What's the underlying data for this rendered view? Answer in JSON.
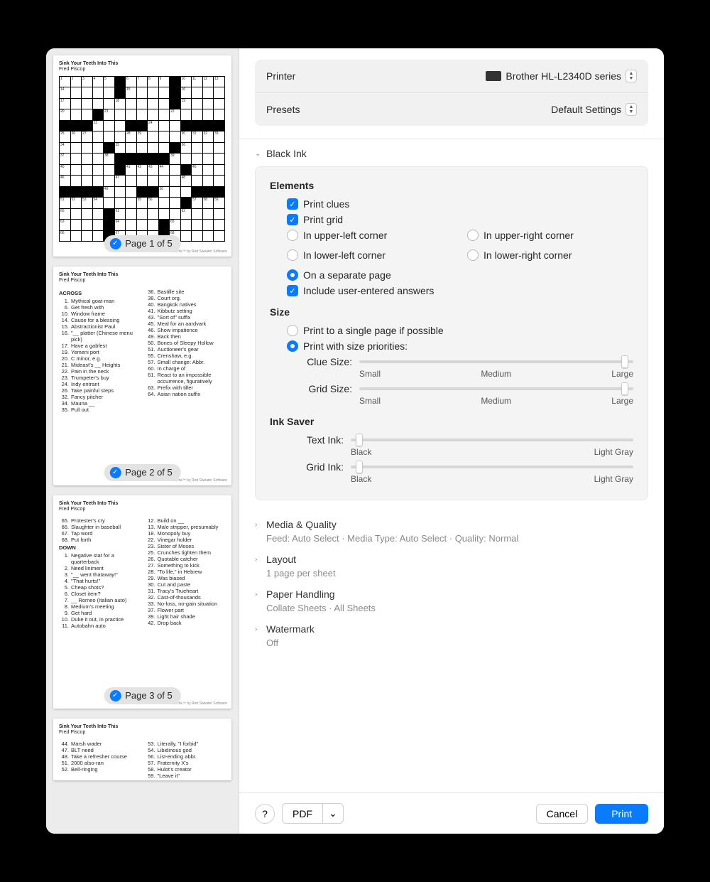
{
  "puzzle": {
    "title": "Sink Your Teeth Into This",
    "author": "Fred Piscop",
    "footer": "…ack Ink™ by Red Sweater Software"
  },
  "grid_rows": [
    [
      {
        "n": "1"
      },
      {
        "n": "2"
      },
      {
        "n": "3"
      },
      {
        "n": "4"
      },
      {
        "n": "5"
      },
      {
        "b": 1
      },
      {
        "n": "6"
      },
      {
        "n": "7"
      },
      {
        "n": "8"
      },
      {
        "n": "9"
      },
      {
        "b": 1
      },
      {
        "n": "10"
      },
      {
        "n": "11"
      },
      {
        "n": "12"
      },
      {
        "n": "13"
      }
    ],
    [
      {
        "n": "14"
      },
      {},
      {},
      {},
      {},
      {
        "b": 1
      },
      {
        "n": "15"
      },
      {},
      {},
      {},
      {
        "b": 1
      },
      {
        "n": "16"
      },
      {},
      {},
      {}
    ],
    [
      {
        "n": "17"
      },
      {},
      {},
      {},
      {},
      {
        "n": "18"
      },
      {},
      {},
      {},
      {},
      {
        "b": 1
      },
      {
        "n": "19"
      },
      {},
      {},
      {}
    ],
    [
      {
        "n": "20"
      },
      {},
      {},
      {
        "b": 1
      },
      {
        "n": "21"
      },
      {},
      {},
      {},
      {},
      {},
      {
        "n": "22"
      },
      {},
      {},
      {},
      {}
    ],
    [
      {
        "b": 1
      },
      {
        "b": 1
      },
      {
        "b": 1
      },
      {
        "n": "23"
      },
      {},
      {},
      {
        "b": 1
      },
      {
        "b": 1
      },
      {
        "n": "24"
      },
      {},
      {},
      {
        "b": 1
      },
      {
        "b": 1
      },
      {
        "b": 1
      },
      {
        "b": 1
      }
    ],
    [
      {
        "n": "25"
      },
      {
        "n": "26"
      },
      {
        "n": "27"
      },
      {},
      {},
      {},
      {
        "n": "28"
      },
      {
        "n": "29"
      },
      {},
      {},
      {},
      {
        "n": "30"
      },
      {
        "n": "31"
      },
      {
        "n": "32"
      },
      {
        "n": "33"
      }
    ],
    [
      {
        "n": "34"
      },
      {},
      {},
      {},
      {
        "b": 1
      },
      {
        "n": "35"
      },
      {},
      {},
      {},
      {},
      {
        "b": 1
      },
      {
        "n": "36"
      },
      {},
      {},
      {}
    ],
    [
      {
        "n": "37"
      },
      {},
      {},
      {},
      {
        "n": "38"
      },
      {
        "b": 1
      },
      {
        "b": 1
      },
      {
        "b": 1
      },
      {
        "b": 1
      },
      {
        "b": 1
      },
      {
        "n": "39"
      },
      {},
      {},
      {},
      {}
    ],
    [
      {
        "n": "40"
      },
      {},
      {},
      {},
      {},
      {
        "b": 1
      },
      {
        "n": "41"
      },
      {
        "n": "42"
      },
      {
        "n": "43"
      },
      {
        "n": "44"
      },
      {},
      {
        "b": 1
      },
      {
        "n": "45"
      },
      {},
      {}
    ],
    [
      {
        "n": "46"
      },
      {},
      {},
      {},
      {},
      {
        "n": "47"
      },
      {},
      {},
      {},
      {},
      {},
      {
        "n": "48"
      },
      {},
      {},
      {}
    ],
    [
      {
        "b": 1
      },
      {
        "b": 1
      },
      {
        "b": 1
      },
      {
        "b": 1
      },
      {
        "n": "49"
      },
      {},
      {},
      {
        "b": 1
      },
      {
        "b": 1
      },
      {
        "n": "50"
      },
      {},
      {},
      {
        "b": 1
      },
      {
        "b": 1
      },
      {
        "b": 1
      }
    ],
    [
      {
        "n": "51"
      },
      {
        "n": "52"
      },
      {
        "n": "53"
      },
      {
        "n": "54"
      },
      {},
      {},
      {},
      {
        "n": "55"
      },
      {
        "n": "56"
      },
      {},
      {},
      {
        "b": 1
      },
      {
        "n": "57"
      },
      {
        "n": "58"
      },
      {
        "n": "59"
      }
    ],
    [
      {
        "n": "60"
      },
      {},
      {},
      {},
      {
        "b": 1
      },
      {
        "n": "61"
      },
      {},
      {},
      {},
      {},
      {},
      {
        "n": "62"
      },
      {},
      {},
      {}
    ],
    [
      {
        "n": "63"
      },
      {},
      {},
      {},
      {
        "b": 1
      },
      {
        "n": "64"
      },
      {},
      {},
      {},
      {
        "b": 1
      },
      {
        "n": "65"
      },
      {},
      {},
      {},
      {}
    ],
    [
      {
        "n": "66"
      },
      {},
      {},
      {},
      {
        "b": 1
      },
      {
        "n": "67"
      },
      {},
      {},
      {},
      {
        "b": 1
      },
      {
        "n": "68"
      },
      {},
      {},
      {},
      {}
    ]
  ],
  "clues": {
    "across1": [
      {
        "n": "1",
        "t": "Mythical goat-man"
      },
      {
        "n": "6",
        "t": "Get fresh with"
      },
      {
        "n": "10",
        "t": "Window frame"
      },
      {
        "n": "14",
        "t": "Cause for a blessing"
      },
      {
        "n": "15",
        "t": "Abstractionist Paul"
      },
      {
        "n": "16",
        "t": "\"__ platter (Chinese menu pick)"
      },
      {
        "n": "17",
        "t": "Have a gabfest"
      },
      {
        "n": "19",
        "t": "Yemeni port"
      },
      {
        "n": "20",
        "t": "C minor, e.g."
      },
      {
        "n": "21",
        "t": "Mideast's __ Heights"
      },
      {
        "n": "22",
        "t": "Pain in the neck"
      },
      {
        "n": "23",
        "t": "Trumpeter's buy"
      },
      {
        "n": "24",
        "t": "Indy entrant"
      },
      {
        "n": "26",
        "t": "Take painful steps"
      },
      {
        "n": "32",
        "t": "Fancy pitcher"
      },
      {
        "n": "34",
        "t": "Mauna __"
      },
      {
        "n": "35",
        "t": "Pull out"
      }
    ],
    "across2": [
      {
        "n": "36",
        "t": "Bastille site"
      },
      {
        "n": "38",
        "t": "Court org."
      },
      {
        "n": "40",
        "t": "Bangkok natives"
      },
      {
        "n": "41",
        "t": "Kibbutz setting"
      },
      {
        "n": "43",
        "t": "\"Sort of\" suffix"
      },
      {
        "n": "45",
        "t": "Meal for an aardvark"
      },
      {
        "n": "46",
        "t": "Show impatience"
      },
      {
        "n": "49",
        "t": "Back then"
      },
      {
        "n": "50",
        "t": "Bones of Sleepy Hollow"
      },
      {
        "n": "51",
        "t": "Auctioneer's gear"
      },
      {
        "n": "55",
        "t": "Crenshaw, e.g."
      },
      {
        "n": "57",
        "t": "Small change: Abbr."
      },
      {
        "n": "60",
        "t": "In charge of"
      },
      {
        "n": "61",
        "t": "React to an impossible occurrence, figuratively"
      },
      {
        "n": "63",
        "t": "Prefix with tiller"
      },
      {
        "n": "64",
        "t": "Asian nation suffix"
      }
    ],
    "p3left": [
      {
        "n": "65",
        "t": "Protester's cry"
      },
      {
        "n": "66",
        "t": "Slaughter in baseball"
      },
      {
        "n": "67",
        "t": "Tap word"
      },
      {
        "n": "68",
        "t": "Put forth"
      }
    ],
    "down1": [
      {
        "n": "1",
        "t": "Negative stat for a quarterback"
      },
      {
        "n": "2",
        "t": "Need liniment"
      },
      {
        "n": "3",
        "t": "\"__ went thataway!\""
      },
      {
        "n": "4",
        "t": "\"That hurts!\""
      },
      {
        "n": "5",
        "t": "Cheap shots?"
      },
      {
        "n": "6",
        "t": "Closet item?"
      },
      {
        "n": "7",
        "t": "__ Romeo (Italian auto)"
      },
      {
        "n": "8",
        "t": "Medium's meeting"
      },
      {
        "n": "9",
        "t": "Get hard"
      },
      {
        "n": "10",
        "t": "Duke it out, in practice"
      },
      {
        "n": "11",
        "t": "Autobahn auto"
      }
    ],
    "down2": [
      {
        "n": "12",
        "t": "Build on __"
      },
      {
        "n": "13",
        "t": "Male stripper, presumably"
      },
      {
        "n": "18",
        "t": "Monopoly buy"
      },
      {
        "n": "22",
        "t": "Vinegar holder"
      },
      {
        "n": "23",
        "t": "Sister of Moses"
      },
      {
        "n": "25",
        "t": "Crunches tighten them"
      },
      {
        "n": "26",
        "t": "Quotable catcher"
      },
      {
        "n": "27",
        "t": "Something to kick"
      },
      {
        "n": "28",
        "t": "\"To life,\" in Hebrew"
      },
      {
        "n": "29",
        "t": "Was biased"
      },
      {
        "n": "30",
        "t": "Cut and paste"
      },
      {
        "n": "31",
        "t": "Tracy's Trueheart"
      },
      {
        "n": "32",
        "t": "Cast-of-thousands"
      },
      {
        "n": "33",
        "t": "No-loss, no-gain situation"
      },
      {
        "n": "37",
        "t": "Flower part"
      },
      {
        "n": "39",
        "t": "Light hair shade"
      },
      {
        "n": "42",
        "t": "Drop back"
      }
    ],
    "p4left": [
      {
        "n": "44",
        "t": "Marsh wader"
      },
      {
        "n": "47",
        "t": "BLT need"
      },
      {
        "n": "48",
        "t": "Take a refresher course"
      },
      {
        "n": "51",
        "t": "2000 also-ran"
      },
      {
        "n": "52",
        "t": "Bell-ringing"
      }
    ],
    "p4right": [
      {
        "n": "53",
        "t": "Literally, \"I forbid\""
      },
      {
        "n": "54",
        "t": "Libidinous god"
      },
      {
        "n": "56",
        "t": "List-ending abbr."
      },
      {
        "n": "57",
        "t": "Fraternity X's"
      },
      {
        "n": "58",
        "t": "Hulot's creator"
      },
      {
        "n": "59",
        "t": "\"Leave it\""
      }
    ]
  },
  "pages": {
    "p1": "Page 1 of 5",
    "p2": "Page 2 of 5",
    "p3": "Page 3 of 5"
  },
  "top": {
    "printer_label": "Printer",
    "printer_value": "Brother HL-L2340D series",
    "presets_label": "Presets",
    "presets_value": "Default Settings"
  },
  "blackink": {
    "title": "Black Ink",
    "elements": {
      "title": "Elements",
      "print_clues": "Print clues",
      "print_grid": "Print grid",
      "ul": "In upper-left corner",
      "ur": "In upper-right corner",
      "ll": "In lower-left corner",
      "lr": "In lower-right corner",
      "sep": "On a separate page",
      "include": "Include user-entered answers"
    },
    "size": {
      "title": "Size",
      "single": "Print to a single page if possible",
      "prio": "Print with size priorities:",
      "clue_label": "Clue Size:",
      "grid_label": "Grid Size:",
      "small": "Small",
      "medium": "Medium",
      "large": "Large"
    },
    "ink": {
      "title": "Ink Saver",
      "text_label": "Text Ink:",
      "grid_label": "Grid Ink:",
      "black": "Black",
      "light": "Light Gray"
    }
  },
  "sections": {
    "media": {
      "title": "Media & Quality",
      "sub": "Feed: Auto Select · Media Type: Auto Select · Quality: Normal"
    },
    "layout": {
      "title": "Layout",
      "sub": "1 page per sheet"
    },
    "paper": {
      "title": "Paper Handling",
      "sub": "Collate Sheets · All Sheets"
    },
    "watermark": {
      "title": "Watermark",
      "sub": "Off"
    }
  },
  "footer": {
    "help": "?",
    "pdf": "PDF",
    "cancel": "Cancel",
    "print": "Print"
  }
}
